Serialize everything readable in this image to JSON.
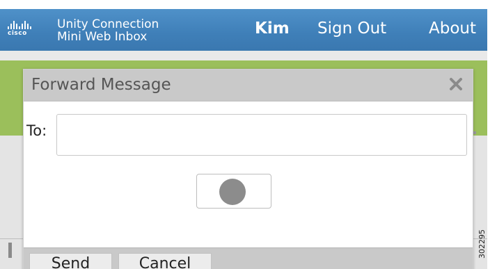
{
  "header": {
    "logo_text": "cisco",
    "app_title_line1": "Unity Connection",
    "app_title_line2": "Mini Web Inbox",
    "user_name": "Kim",
    "sign_out_label": "Sign Out",
    "about_label": "About"
  },
  "dialog": {
    "title": "Forward Message",
    "close_icon": "close-icon",
    "to_label": "To:",
    "to_value": "",
    "record_icon": "record-icon",
    "send_label": "Send",
    "cancel_label": "Cancel"
  },
  "figure_id": "302295",
  "colors": {
    "header_blue": "#4286c2",
    "accent_green": "#9bbf5b",
    "dialog_title_bg": "#c9c9c9",
    "record_dot": "#8c8c8c"
  }
}
